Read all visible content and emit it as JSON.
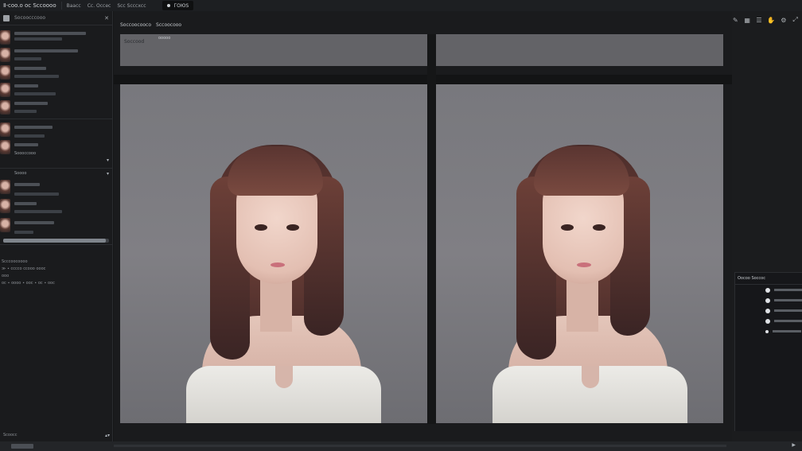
{
  "app": {
    "title": "Ⅱ-coo.o ос Ѕссоооо",
    "menus": [
      "Ваасс",
      "Сс. Оcсес",
      "Ѕсс Ѕсссхсс"
    ],
    "pill_label": "ГОЮЅ"
  },
  "left_panel": {
    "header_title": "Ѕосоосссооо",
    "close_glyph": "✕",
    "groups": [
      {
        "label": "Ѕоооссооо",
        "caret": "▾"
      },
      {
        "label": "Ѕоооо",
        "caret": "▾"
      },
      {
        "label": "Сооо",
        "caret": "▾"
      }
    ],
    "progress_fraction": 0.97,
    "log": [
      "Ѕсссоосоооо",
      "≫ ∙ ссссо ссооо ооос",
      "ооо",
      "ос ∙ оооо ∙ оос ∙ ос ∙ оос"
    ],
    "footer_text": "Ѕсоосс",
    "footer_caret": "▴▾"
  },
  "main": {
    "tabs": [
      "Ѕоссоосоосо",
      "Ѕссоосооо"
    ],
    "caption_left": "Ѕоссооd",
    "caption_chip": "ооооо"
  },
  "right_panel": {
    "icons": [
      "pen-icon",
      "grid-icon",
      "list-icon",
      "hand-icon",
      "gear-icon",
      "expand-icon"
    ],
    "icon_glyphs": [
      "✎",
      "▦",
      "☰",
      "✋",
      "⚙",
      "⤢"
    ],
    "layers_title": "Оосоо Ѕоссос",
    "layers_count": 5
  },
  "bottom": {
    "render_glyph": "▶"
  },
  "colors": {
    "bg": "#151617",
    "panel": "#1a1b1d",
    "caption": "#636367"
  }
}
